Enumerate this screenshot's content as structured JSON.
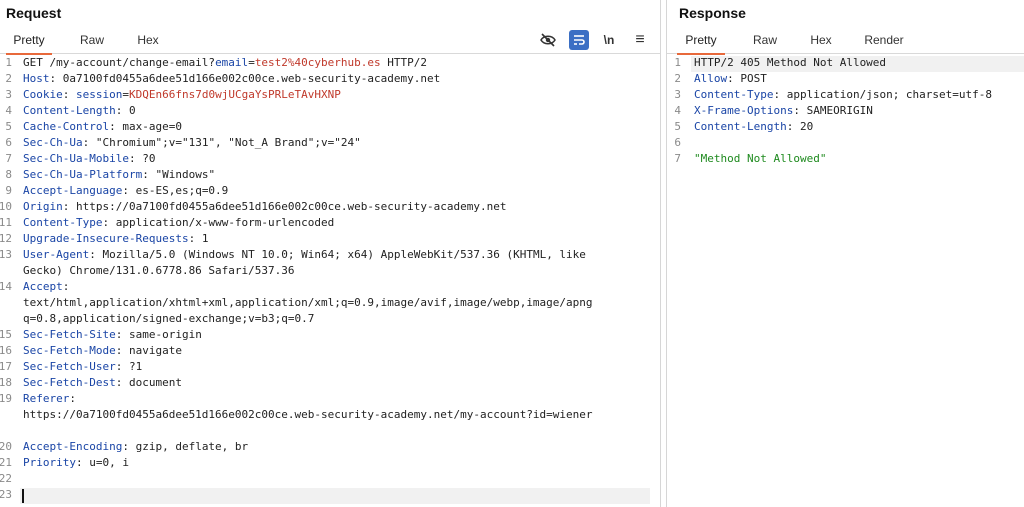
{
  "request": {
    "title": "Request",
    "tabs": [
      "Pretty",
      "Raw",
      "Hex"
    ],
    "tools": [
      {
        "name": "hide-icon",
        "glyph": ""
      },
      {
        "name": "wrap-lines-icon",
        "glyph": ""
      },
      {
        "name": "newline-icon",
        "glyph": "\\n"
      },
      {
        "name": "menu-icon",
        "glyph": "≡"
      }
    ]
  },
  "response": {
    "title": "Response",
    "tabs": [
      "Pretty",
      "Raw",
      "Hex",
      "Render"
    ]
  },
  "request_lines": [
    {
      "n": "1",
      "parts": [
        [
          "GET /my-account/change-email?",
          ""
        ],
        [
          "email",
          "k"
        ],
        [
          "=",
          ""
        ],
        [
          "test2%40cyberhub.es",
          "r"
        ],
        [
          " HTTP/2",
          ""
        ]
      ]
    },
    {
      "n": "2",
      "parts": [
        [
          "Host",
          ""
        ],
        [
          ": 0a7100fd0455a6dee51d166e002c00ce.web-security-academy.net",
          ""
        ]
      ],
      "key": "Host"
    },
    {
      "n": "3",
      "parts": [
        [
          "Cookie",
          "k"
        ],
        [
          ": ",
          ""
        ],
        [
          "session",
          "k"
        ],
        [
          "=",
          ""
        ],
        [
          "KDQEn66fns7d0wjUCgaYsPRLeTAvHXNP",
          "r"
        ]
      ]
    },
    {
      "n": "4",
      "parts": [
        [
          "Content-Length",
          "k"
        ],
        [
          ": 0",
          ""
        ]
      ]
    },
    {
      "n": "5",
      "parts": [
        [
          "Cache-Control",
          "k"
        ],
        [
          ": max-age=0",
          ""
        ]
      ]
    },
    {
      "n": "6",
      "parts": [
        [
          "Sec-Ch-Ua",
          "k"
        ],
        [
          ": \"Chromium\";v=\"131\", \"Not_A Brand\";v=\"24\"",
          ""
        ]
      ]
    },
    {
      "n": "7",
      "parts": [
        [
          "Sec-Ch-Ua-Mobile",
          "k"
        ],
        [
          ": ?0",
          ""
        ]
      ]
    },
    {
      "n": "8",
      "parts": [
        [
          "Sec-Ch-Ua-Platform",
          "k"
        ],
        [
          ": \"Windows\"",
          ""
        ]
      ]
    },
    {
      "n": "9",
      "parts": [
        [
          "Accept-Language",
          "k"
        ],
        [
          ": es-ES,es;q=0.9",
          ""
        ]
      ]
    },
    {
      "n": "10",
      "parts": [
        [
          "Origin",
          "k"
        ],
        [
          ": https://0a7100fd0455a6dee51d166e002c00ce.web-security-academy.net",
          ""
        ]
      ]
    },
    {
      "n": "11",
      "parts": [
        [
          "Content-Type",
          "k"
        ],
        [
          ": application/x-www-form-urlencoded",
          ""
        ]
      ]
    },
    {
      "n": "12",
      "parts": [
        [
          "Upgrade-Insecure-Requests",
          "k"
        ],
        [
          ": 1",
          ""
        ]
      ]
    },
    {
      "n": "13",
      "parts": [
        [
          "User-Agent",
          "k"
        ],
        [
          ": Mozilla/5.0 (Windows NT 10.0; Win64; x64) AppleWebKit/537.36 (KHTML, like",
          ""
        ]
      ]
    },
    {
      "n": "",
      "parts": [
        [
          "Gecko) Chrome/131.0.6778.86 Safari/537.36",
          ""
        ]
      ]
    },
    {
      "n": "14",
      "parts": [
        [
          "Accept",
          "k"
        ],
        [
          ":",
          ""
        ]
      ]
    },
    {
      "n": "",
      "parts": [
        [
          "text/html,application/xhtml+xml,application/xml;q=0.9,image/avif,image/webp,image/apng",
          ""
        ]
      ]
    },
    {
      "n": "",
      "parts": [
        [
          "q=0.8,application/signed-exchange;v=b3;q=0.7",
          ""
        ]
      ]
    },
    {
      "n": "15",
      "parts": [
        [
          "Sec-Fetch-Site",
          "k"
        ],
        [
          ": same-origin",
          ""
        ]
      ]
    },
    {
      "n": "16",
      "parts": [
        [
          "Sec-Fetch-Mode",
          "k"
        ],
        [
          ": navigate",
          ""
        ]
      ]
    },
    {
      "n": "17",
      "parts": [
        [
          "Sec-Fetch-User",
          "k"
        ],
        [
          ": ?1",
          ""
        ]
      ]
    },
    {
      "n": "18",
      "parts": [
        [
          "Sec-Fetch-Dest",
          "k"
        ],
        [
          ": document",
          ""
        ]
      ]
    },
    {
      "n": "19",
      "parts": [
        [
          "Referer",
          "k"
        ],
        [
          ":",
          ""
        ]
      ]
    },
    {
      "n": "",
      "parts": [
        [
          "https://0a7100fd0455a6dee51d166e002c00ce.web-security-academy.net/my-account?id=wiener",
          ""
        ]
      ]
    },
    {
      "n": "",
      "parts": []
    },
    {
      "n": "20",
      "parts": [
        [
          "Accept-Encoding",
          "k"
        ],
        [
          ": gzip, deflate, br",
          ""
        ]
      ]
    },
    {
      "n": "21",
      "parts": [
        [
          "Priority",
          "k"
        ],
        [
          ": u=0, i",
          ""
        ]
      ]
    },
    {
      "n": "22",
      "parts": []
    },
    {
      "n": "23",
      "parts": []
    }
  ],
  "response_lines": [
    {
      "n": "1",
      "parts": [
        [
          "HTTP/2 405 Method Not Allowed",
          ""
        ]
      ]
    },
    {
      "n": "2",
      "parts": [
        [
          "Allow",
          "k"
        ],
        [
          ": POST",
          ""
        ]
      ]
    },
    {
      "n": "3",
      "parts": [
        [
          "Content-Type",
          "k"
        ],
        [
          ": application/json; charset=utf-8",
          ""
        ]
      ]
    },
    {
      "n": "4",
      "parts": [
        [
          "X-Frame-Options",
          "k"
        ],
        [
          ": SAMEORIGIN",
          ""
        ]
      ]
    },
    {
      "n": "5",
      "parts": [
        [
          "Content-Length",
          "k"
        ],
        [
          ": 20",
          ""
        ]
      ]
    },
    {
      "n": "6",
      "parts": []
    },
    {
      "n": "7",
      "parts": [
        [
          "\"Method Not Allowed\"",
          "g"
        ]
      ]
    }
  ],
  "colors": {
    "accent": "#e8693b",
    "header_key": "#1a45a6",
    "string_red": "#c0392b",
    "string_green": "#1e8a1e",
    "active_tool": "#3b6fc4"
  }
}
